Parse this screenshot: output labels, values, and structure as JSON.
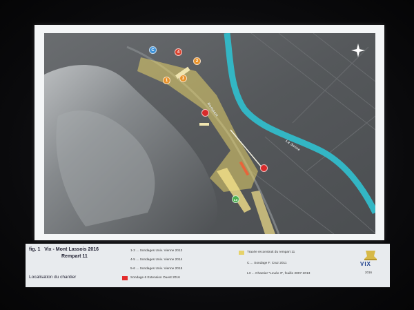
{
  "figure": {
    "label": "fig. 1",
    "title": "Vix - Mont Lassois 2016",
    "subtitle_line": "Rempart 11",
    "caption": "Localisation du chantier"
  },
  "map": {
    "river_label": "La Seine",
    "rampart_label": "Rempart",
    "compass": "north-star-icon",
    "markers": [
      {
        "label": "1",
        "color": "#e8922a"
      },
      {
        "label": "2",
        "color": "#e8922a"
      },
      {
        "label": "3",
        "color": "#e8922a"
      },
      {
        "label": "4",
        "color": "#d9432f"
      },
      {
        "label": "C",
        "color": "#3a8fd6"
      },
      {
        "label": "",
        "color": "#d92a2a"
      },
      {
        "label": "",
        "color": "#d92a2a"
      },
      {
        "label": "L3",
        "color": "#4caf50"
      }
    ],
    "colors": {
      "terrain": "#5b5e61",
      "river": "#33b6c4",
      "trace": "#e6d26a",
      "sondage_red": "#e32b2b"
    }
  },
  "legend": {
    "left": [
      {
        "code": "1-3",
        "text": "1-3 ... Sondages Univ. Vienne 2013"
      },
      {
        "code": "4-5",
        "text": "4-5 ... Sondages Univ. Vienne 2014"
      },
      {
        "code": "5-6",
        "text": "5-6 ... Sondages Univ. Vienne 2015"
      },
      {
        "code": "red",
        "text": "Sondage 6 Extension Ouest 2016"
      }
    ],
    "right": [
      {
        "code": "yellow",
        "text": "Tracée reconstruit du rempart 11"
      },
      {
        "code": "C",
        "text": "C ... Sondage F. Cruz 2011"
      },
      {
        "code": "L3",
        "text": "L3 ... Chantier \"Levée 3\", fouille 2007-2013"
      }
    ],
    "logo_text": "VIX",
    "logo_year": "2016"
  }
}
